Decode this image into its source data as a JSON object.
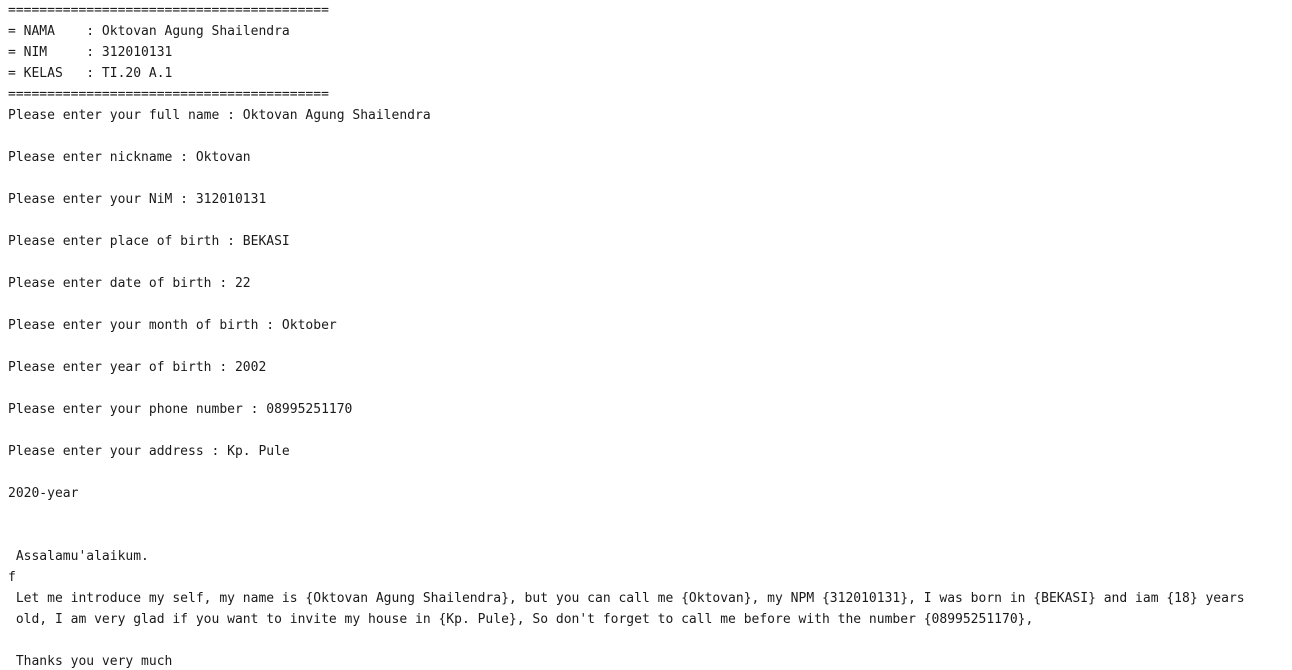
{
  "console": {
    "header": {
      "rule_top": "=========================================",
      "nama": "= NAMA    : Oktovan Agung Shailendra",
      "nim": "= NIM     : 312010131",
      "kelas": "= KELAS   : TI.20 A.1",
      "rule_bottom": "========================================="
    },
    "prompts": [
      "Please enter your full name : Oktovan Agung Shailendra",
      "Please enter nickname : Oktovan",
      "Please enter your NiM : 312010131",
      "Please enter place of birth : BEKASI",
      "Please enter date of birth : 22",
      "Please enter your month of birth : Oktober",
      "Please enter year of birth : 2002",
      "Please enter your phone number : 08995251170",
      "Please enter your address : Kp. Pule"
    ],
    "year_line": "2020-year",
    "letter": {
      "greeting": " Assalamu'alaikum.",
      "stray": "f",
      "body_line1": " Let me introduce my self, my name is {Oktovan Agung Shailendra}, but you can call me {Oktovan}, my NPM {312010131}, I was born in {BEKASI} and iam {18} years",
      "body_line2": " old, I am very glad if you want to invite my house in {Kp. Pule}, So don't forget to call me before with the number {08995251170},",
      "closing": " Thanks you very much"
    }
  }
}
